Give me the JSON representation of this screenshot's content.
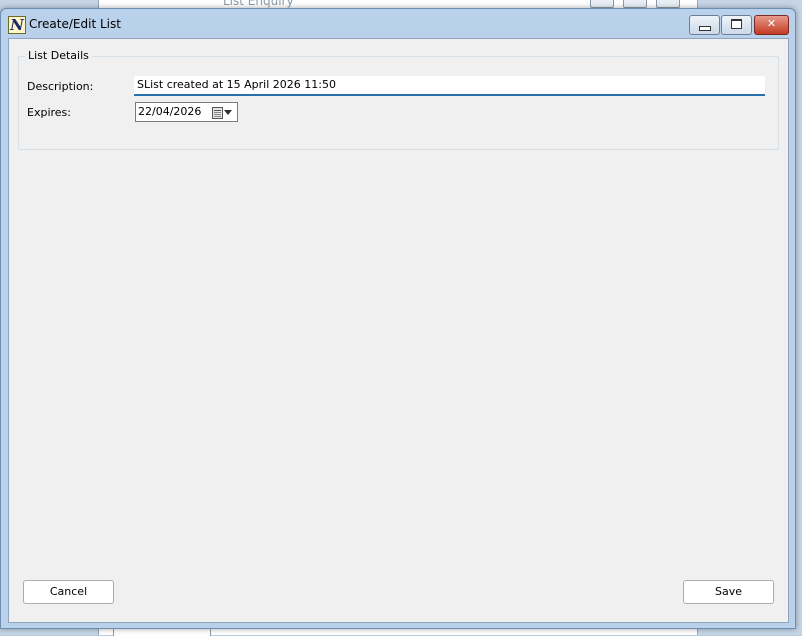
{
  "background": {
    "window_title": "List Enquiry"
  },
  "window": {
    "title": "Create/Edit List",
    "app_icon_glyph": "N",
    "controls": {
      "minimize": "minimize-icon",
      "maximize": "maximize-icon",
      "close": "close-icon"
    },
    "close_glyph": "✕"
  },
  "group": {
    "legend": "List Details"
  },
  "form": {
    "description_label": "Description:",
    "description_value": "SList created at 15 April 2026 11:50",
    "expires_label": "Expires:",
    "expires_value": "22/04/2026"
  },
  "buttons": {
    "cancel": "Cancel",
    "save": "Save"
  },
  "colors": {
    "focus_underline": "#2a6fad",
    "close_button": "#c23b22",
    "client_background": "#f0f0f0"
  }
}
